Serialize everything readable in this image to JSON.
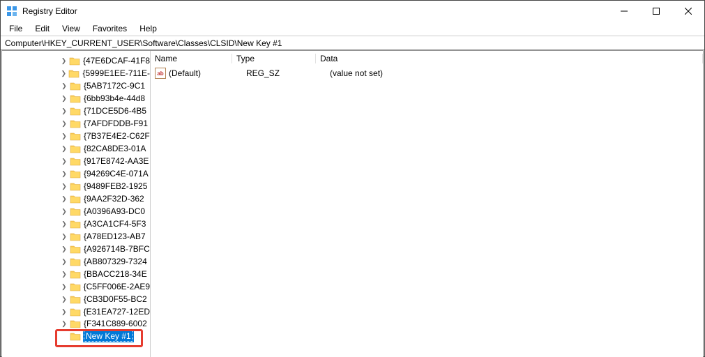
{
  "window": {
    "title": "Registry Editor"
  },
  "menu": {
    "file": "File",
    "edit": "Edit",
    "view": "View",
    "favorites": "Favorites",
    "help": "Help"
  },
  "address": "Computer\\HKEY_CURRENT_USER\\Software\\Classes\\CLSID\\New Key #1",
  "tree": {
    "items": [
      "{47E6DCAF-41F8",
      "{5999E1EE-711E-",
      "{5AB7172C-9C1",
      "{6bb93b4e-44d8",
      "{71DCE5D6-4B5",
      "{7AFDFDDB-F91",
      "{7B37E4E2-C62F",
      "{82CA8DE3-01A",
      "{917E8742-AA3E",
      "{94269C4E-071A",
      "{9489FEB2-1925",
      "{9AA2F32D-362",
      "{A0396A93-DC0",
      "{A3CA1CF4-5F3",
      "{A78ED123-AB7",
      "{A926714B-7BFC",
      "{AB807329-7324",
      "{BBACC218-34E",
      "{C5FF006E-2AE9",
      "{CB3D0F55-BC2",
      "{E31EA727-12ED",
      "{F341C889-6002"
    ],
    "newItem": "New Key #1"
  },
  "columns": {
    "name": "Name",
    "type": "Type",
    "data": "Data"
  },
  "values": [
    {
      "name": "(Default)",
      "type": "REG_SZ",
      "data": "(value not set)"
    }
  ]
}
